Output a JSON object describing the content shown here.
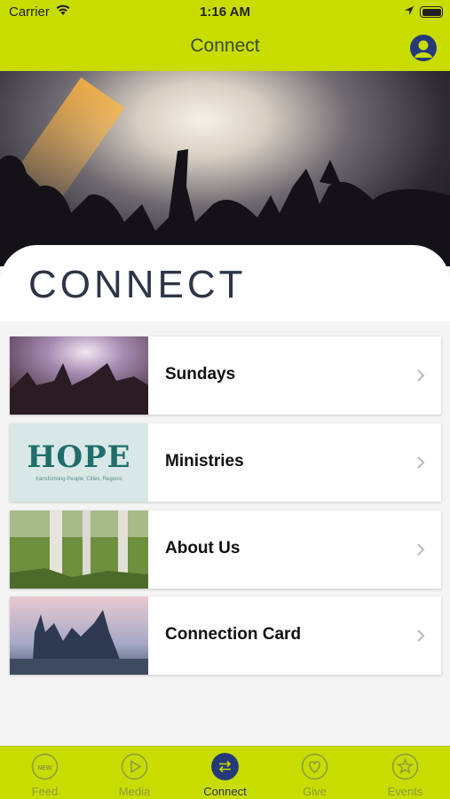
{
  "status_bar": {
    "carrier": "Carrier",
    "time": "1:16 AM"
  },
  "nav": {
    "title": "Connect"
  },
  "section": {
    "heading": "CONNECT"
  },
  "items": [
    {
      "label": "Sundays"
    },
    {
      "label": "Ministries",
      "thumb_logo": "HOPE",
      "thumb_tagline": "transforming People, Cities, Regions"
    },
    {
      "label": "About Us"
    },
    {
      "label": "Connection Card"
    }
  ],
  "tabs": [
    {
      "label": "Feed",
      "icon": "new-icon",
      "badge": "NEW"
    },
    {
      "label": "Media",
      "icon": "play-icon"
    },
    {
      "label": "Connect",
      "icon": "connect-arrows-icon"
    },
    {
      "label": "Give",
      "icon": "heart-icon"
    },
    {
      "label": "Events",
      "icon": "star-icon"
    }
  ],
  "colors": {
    "brand": "#c8dc00",
    "active_tab": "#243a7a",
    "inactive_tab": "#8c9a40",
    "heading": "#2e3548"
  }
}
